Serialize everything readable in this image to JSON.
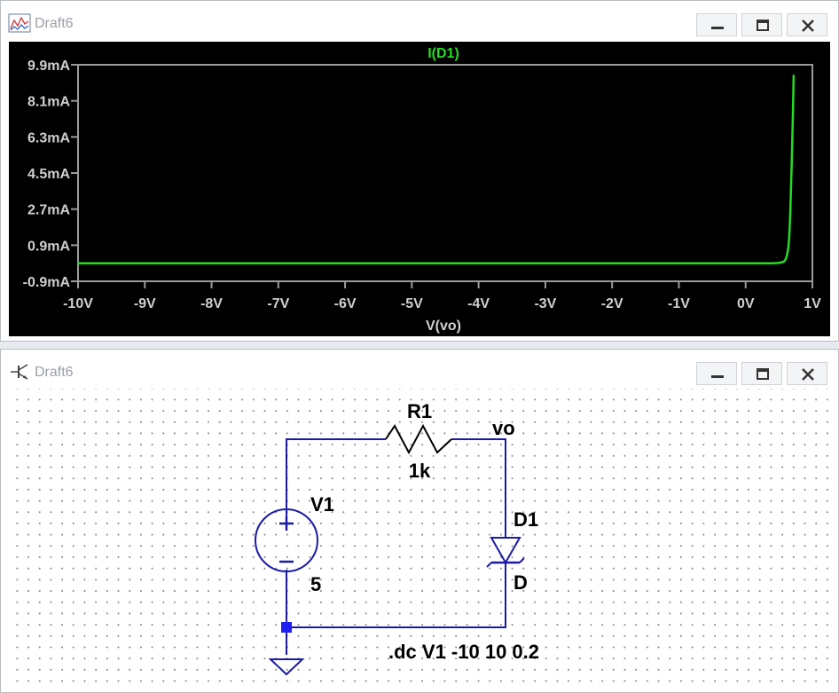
{
  "plot_window": {
    "title": "Draft6",
    "icon": "waveform-icon",
    "buttons": {
      "minimize": "minimize-icon",
      "maximize": "maximize-icon",
      "close": "close-icon"
    }
  },
  "schematic_window": {
    "title": "Draft6",
    "icon": "transistor-icon",
    "buttons": {
      "minimize": "minimize-icon",
      "maximize": "maximize-icon",
      "close": "close-icon"
    }
  },
  "chart_data": {
    "type": "line",
    "title": "I(D1)",
    "xlabel": "V(vo)",
    "ylabel": "",
    "x_ticks": [
      "-10V",
      "-9V",
      "-8V",
      "-7V",
      "-6V",
      "-5V",
      "-4V",
      "-3V",
      "-2V",
      "-1V",
      "0V",
      "1V"
    ],
    "y_ticks": [
      "9.9mA",
      "8.1mA",
      "6.3mA",
      "4.5mA",
      "2.7mA",
      "0.9mA",
      "-0.9mA"
    ],
    "xlim": [
      -10,
      1
    ],
    "ylim": [
      -0.9,
      9.9
    ],
    "grid": false,
    "series": [
      {
        "name": "I(D1)",
        "color": "#22dd22",
        "x": [
          -10,
          -5,
          0,
          0.4,
          0.5,
          0.55,
          0.58,
          0.6,
          0.62,
          0.64,
          0.65,
          0.66,
          0.67,
          0.68,
          0.69,
          0.7,
          0.71,
          0.72
        ],
        "y": [
          0,
          0,
          0,
          0,
          0.02,
          0.05,
          0.1,
          0.2,
          0.4,
          0.8,
          1.2,
          1.8,
          2.7,
          3.8,
          5.0,
          6.3,
          7.8,
          9.4
        ]
      }
    ]
  },
  "schematic": {
    "source": {
      "name": "V1",
      "value": "5"
    },
    "resistor": {
      "name": "R1",
      "value": "1k"
    },
    "diode": {
      "name": "D1",
      "value": "D"
    },
    "net_label": "vo",
    "directive": ".dc V1 -10 10 0.2",
    "wire_color": "#1a1aa6",
    "junction_color": "#1f1ff0"
  }
}
